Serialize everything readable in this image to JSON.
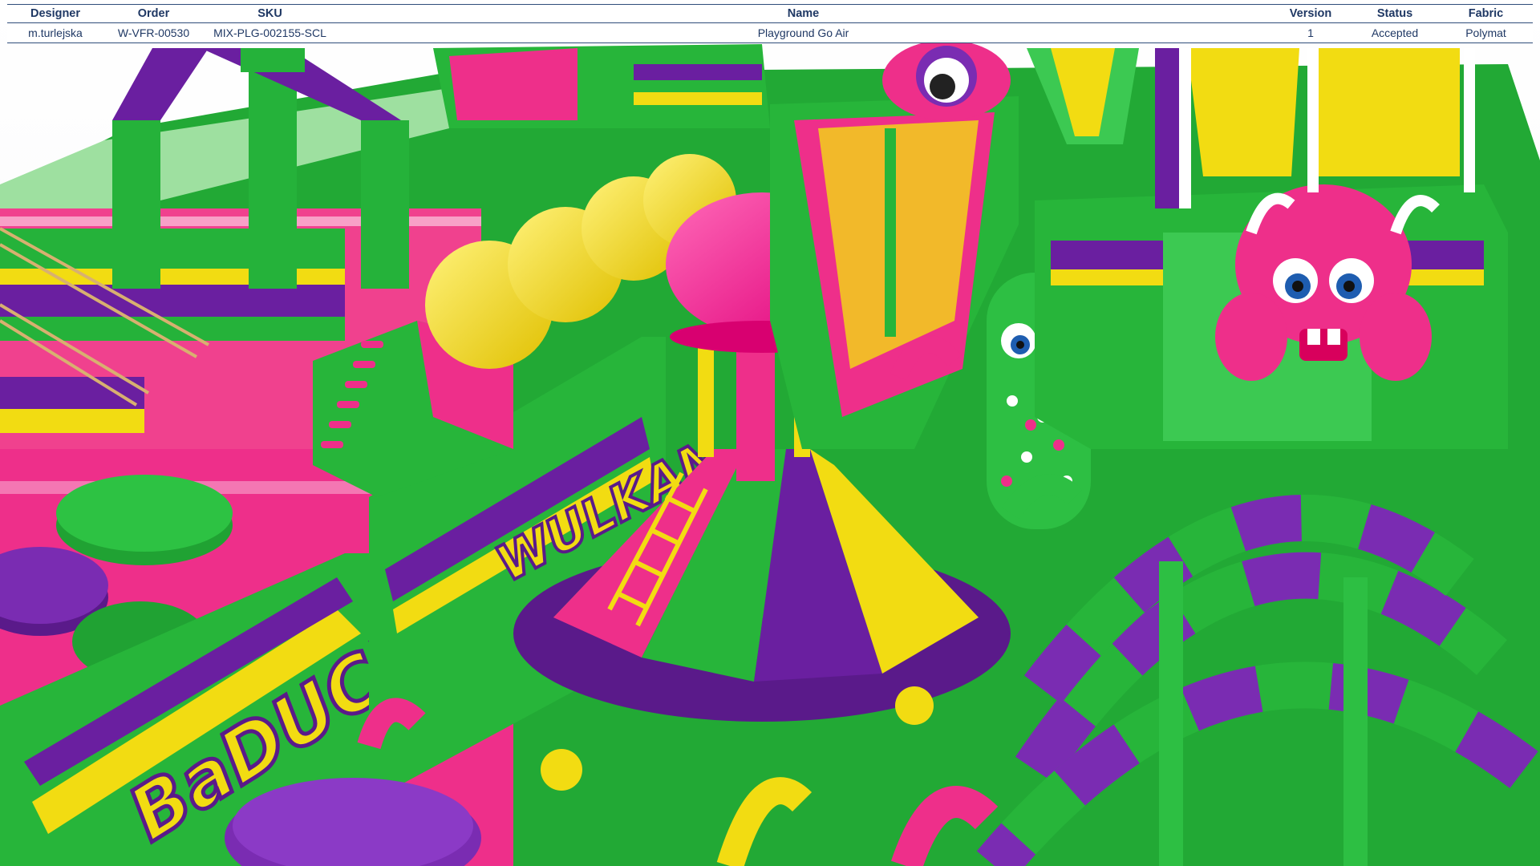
{
  "spec_table": {
    "headers": {
      "designer": "Designer",
      "order": "Order",
      "sku": "SKU",
      "name": "Name",
      "version": "Version",
      "status": "Status",
      "fabric": "Fabric"
    },
    "row": {
      "designer": "m.turlejska",
      "order": "W-VFR-00530",
      "sku": "MIX-PLG-002155-SCL",
      "name": "Playground Go Air",
      "version": "1",
      "status": "Accepted",
      "fabric": "Polymat"
    }
  },
  "render": {
    "banner_left": "BaDUCHA",
    "banner_center": "WULKAN",
    "colors": {
      "green": "#27b53a",
      "purple": "#6a1fa0",
      "pink": "#ff1f8e",
      "yellow": "#f5dc0a",
      "header_text": "#1f3864",
      "rule": "#2f4d7a"
    }
  }
}
